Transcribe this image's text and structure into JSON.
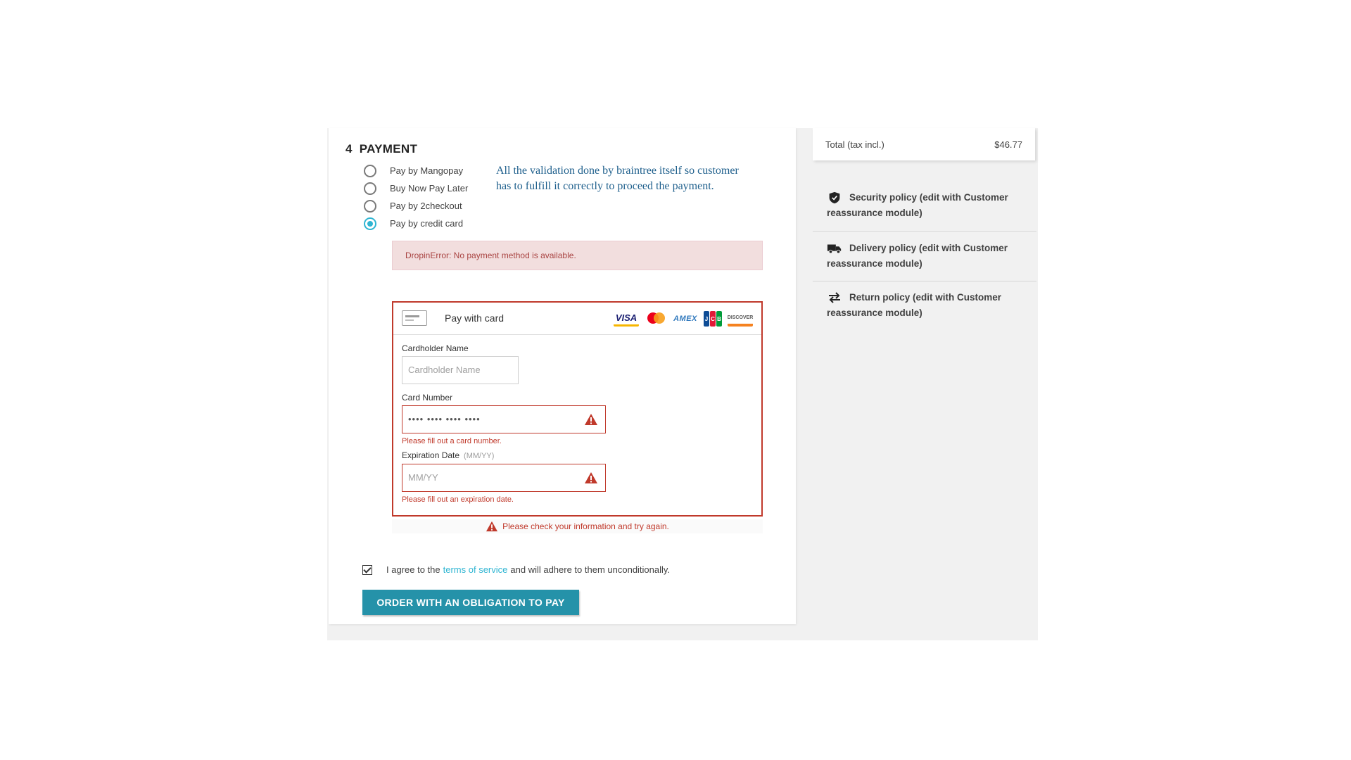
{
  "payment": {
    "step_number": "4",
    "step_title": "PAYMENT",
    "options": [
      {
        "label": "Pay by Mangopay",
        "selected": false
      },
      {
        "label": "Buy Now Pay Later",
        "selected": false
      },
      {
        "label": "Pay by 2checkout",
        "selected": false
      },
      {
        "label": "Pay by credit card",
        "selected": true
      }
    ],
    "annotation": "All the validation done by braintree itself so customer has to fulfill it correctly to proceed the payment.",
    "dropin_error": "DropinError: No payment method is available.",
    "card_form": {
      "title": "Pay with card",
      "brands": [
        "VISA",
        "Mastercard",
        "AMEX",
        "JCB",
        "DISCOVER"
      ],
      "cardholder_label": "Cardholder Name",
      "cardholder_placeholder": "Cardholder Name",
      "card_number_label": "Card Number",
      "card_number_value": "•••• •••• •••• ••••",
      "card_number_error": "Please fill out a card number.",
      "expiration_label": "Expiration Date",
      "expiration_hint": "(MM/YY)",
      "expiration_placeholder": "MM/YY",
      "expiration_error": "Please fill out an expiration date."
    },
    "global_error": "Please check your information and try again.",
    "terms": {
      "before": "I agree to the",
      "link": "terms of service",
      "after": "and will adhere to them unconditionally.",
      "checked": true
    },
    "order_button": "ORDER WITH AN OBLIGATION TO PAY"
  },
  "sidebar": {
    "total_label": "Total (tax incl.)",
    "total_value": "$46.77",
    "policies": [
      {
        "icon": "shield-icon",
        "text": "Security policy (edit with Customer reassurance module)"
      },
      {
        "icon": "truck-icon",
        "text": "Delivery policy (edit with Customer reassurance module)"
      },
      {
        "icon": "swap-arrows-icon",
        "text": "Return policy (edit with Customer reassurance module)"
      }
    ]
  },
  "colors": {
    "accent": "#2fb5d2",
    "button": "#2592a9",
    "error": "#c0392b",
    "annotation": "#1e5f8c"
  }
}
